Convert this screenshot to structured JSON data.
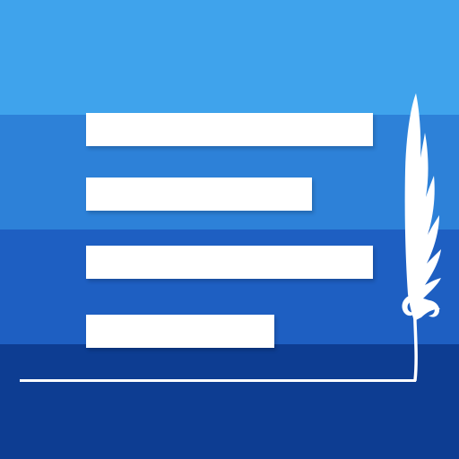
{
  "icon": {
    "name": "text-editor-feather-icon",
    "colors": {
      "band_1": "#3fa3ec",
      "band_2": "#2d81d8",
      "band_3": "#1e5fc2",
      "band_4": "#0d3d92",
      "foreground": "#ffffff"
    },
    "text_line_count": 4,
    "feather_icon": "quill-feather-icon"
  }
}
